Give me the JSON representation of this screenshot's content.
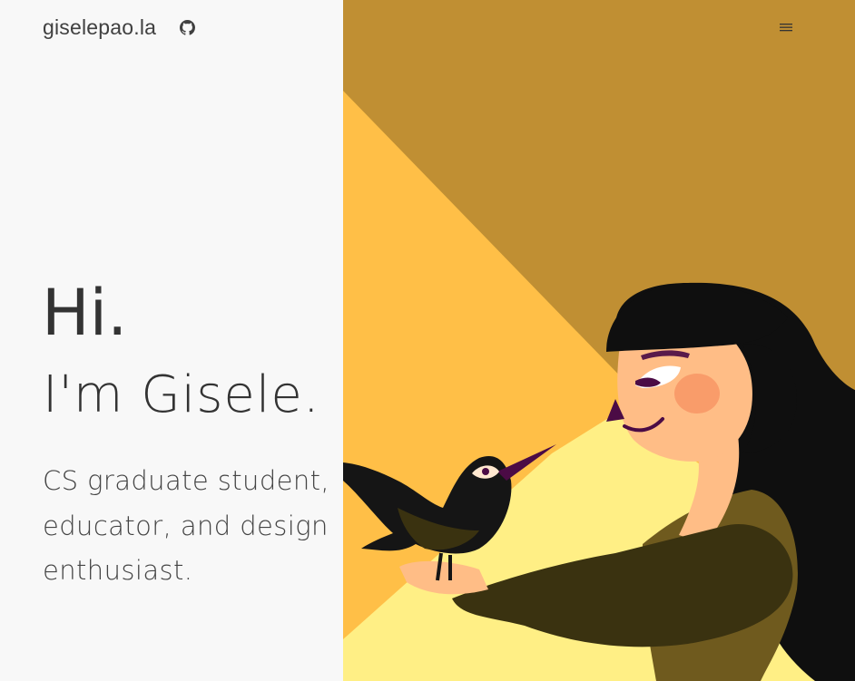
{
  "header": {
    "site_title": "giselepao.la",
    "github_icon": "github-icon",
    "menu_icon": "hamburger-menu-icon"
  },
  "hero": {
    "greeting": "Hi.",
    "intro": "I'm Gisele.",
    "tagline": "CS graduate student, educator, and design enthusiast."
  },
  "colors": {
    "left_bg": "#f8f8f8",
    "art_bg": "#c08f33",
    "light_beam": "#ffbf47",
    "pale_beam": "#ffef85",
    "skin": "#ffbd86",
    "hair": "#0f0f0f",
    "sweater": "#6f5a1e",
    "crow": "#151515",
    "beak": "#4b0b45"
  }
}
